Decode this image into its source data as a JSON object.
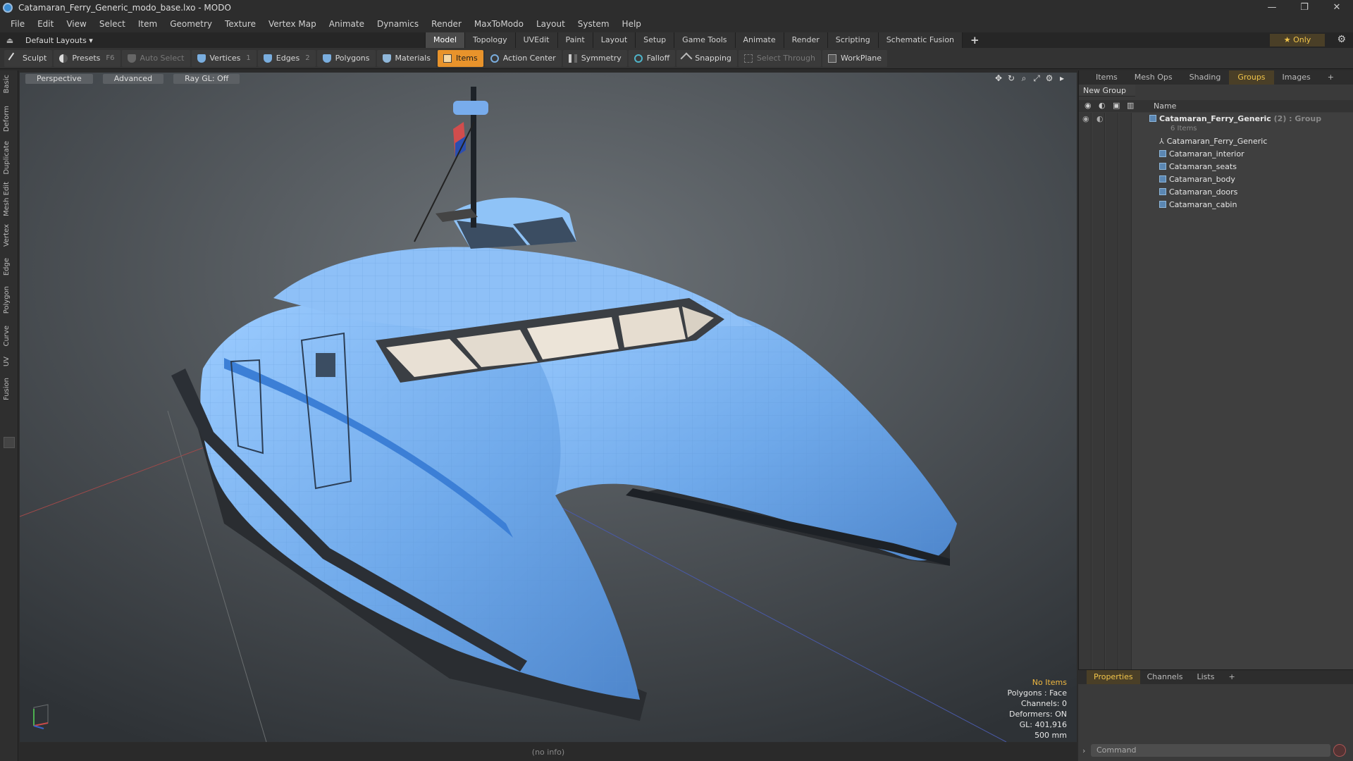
{
  "window": {
    "title": "Catamaran_Ferry_Generic_modo_base.lxo - MODO",
    "controls": [
      "—",
      "❐",
      "✕"
    ]
  },
  "menu": [
    "File",
    "Edit",
    "View",
    "Select",
    "Item",
    "Geometry",
    "Texture",
    "Vertex Map",
    "Animate",
    "Dynamics",
    "Render",
    "MaxToModo",
    "Layout",
    "System",
    "Help"
  ],
  "layoutbar": {
    "layouts_label": "Default Layouts ▾",
    "tabs": [
      "Model",
      "Topology",
      "UVEdit",
      "Paint",
      "Layout",
      "Setup",
      "Game Tools",
      "Animate",
      "Render",
      "Scripting",
      "Schematic Fusion"
    ],
    "active_tab": "Model",
    "plus": "+",
    "only_label": "★  Only"
  },
  "toolbar": {
    "sculpt": "Sculpt",
    "presets": "Presets",
    "presets_key": "F6",
    "auto_select": "Auto Select",
    "vertices": "Vertices",
    "vertices_key": "1",
    "edges": "Edges",
    "edges_key": "2",
    "polygons": "Polygons",
    "materials": "Materials",
    "items": "Items",
    "action_center": "Action Center",
    "symmetry": "Symmetry",
    "falloff": "Falloff",
    "snapping": "Snapping",
    "select_through": "Select Through",
    "workplane": "WorkPlane"
  },
  "leftstrip": [
    "Basic",
    "Deform",
    "Duplicate",
    "Mesh Edit",
    "Vertex",
    "Edge",
    "Polygon",
    "Curve",
    "UV",
    "Fusion"
  ],
  "viewport": {
    "view": "Perspective",
    "shading": "Advanced",
    "raygl": "Ray GL: Off",
    "stats": {
      "no_items": "No Items",
      "polygons": "Polygons : Face",
      "channels": "Channels: 0",
      "deformers": "Deformers: ON",
      "gl": "GL: 401,916",
      "size": "500 mm"
    }
  },
  "status": "(no info)",
  "right_panel": {
    "tabs": [
      "Items",
      "Mesh Ops",
      "Shading",
      "Groups",
      "Images",
      "+"
    ],
    "active_tab": "Groups",
    "new_group": "New Group",
    "name_header": "Name",
    "group": {
      "name": "Catamaran_Ferry_Generic",
      "meta": "(2) : Group",
      "count": "6 Items"
    },
    "items": [
      "Catamaran_Ferry_Generic",
      "Catamaran_interior",
      "Catamaran_seats",
      "Catamaran_body",
      "Catamaran_doors",
      "Catamaran_cabin"
    ]
  },
  "bottom_panel": {
    "tabs": [
      "Properties",
      "Channels",
      "Lists",
      "+"
    ],
    "active_tab": "Properties",
    "command_placeholder": "Command"
  },
  "colors": {
    "accent": "#e8932b",
    "hull": "#7ab4f0",
    "viewport_bg": "#4d5256"
  }
}
